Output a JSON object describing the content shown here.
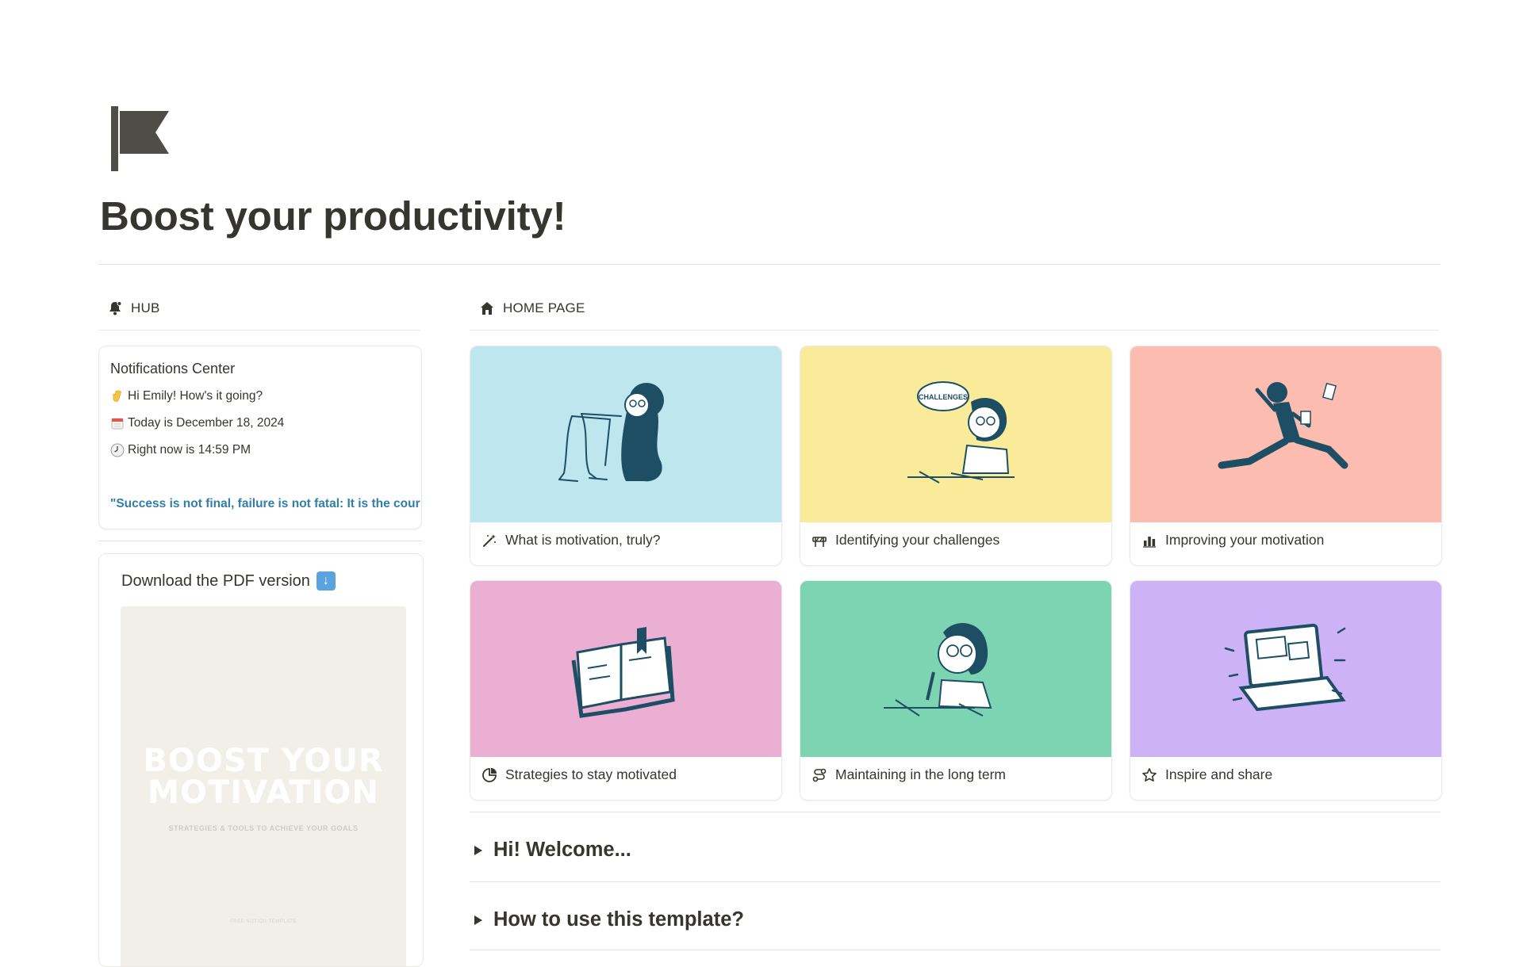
{
  "page": {
    "title": "Boost your productivity!",
    "icon": "flag-icon"
  },
  "hub": {
    "header_label": "HUB",
    "header_icon": "bell-icon",
    "notifications": {
      "title": "Notifications Center",
      "greeting": "Hi Emily! How's it going?",
      "greeting_icon": "waving-hand-icon",
      "date_text": "Today is December 18, 2024",
      "date_icon": "calendar-icon",
      "time_text": "Right now is 14:59 PM",
      "time_icon": "clock-icon",
      "quote": "\"Success is not final, failure is not fatal: It is the cour"
    },
    "download": {
      "title": "Download the PDF version",
      "title_icon": "down-arrow-icon",
      "preview_title_line1": "BOOST YOUR",
      "preview_title_line2": "MOTIVATION",
      "preview_subtitle": "STRATEGIES & TOOLS TO ACHIEVE YOUR GOALS",
      "preview_footer": "FREE NOTION TEMPLATE"
    }
  },
  "home": {
    "header_label": "HOME PAGE",
    "header_icon": "house-icon",
    "cards": [
      {
        "label": "What is motivation, truly?",
        "icon": "magic-wand-icon",
        "cover_color": "#bde6ee"
      },
      {
        "label": "Identifying your challenges",
        "icon": "road-barrier-icon",
        "cover_color": "#faeb9b"
      },
      {
        "label": "Improving your motivation",
        "icon": "bar-chart-icon",
        "cover_color": "#fcbdb0"
      },
      {
        "label": "Strategies to stay motivated",
        "icon": "pie-chart-icon",
        "cover_color": "#ecafd4"
      },
      {
        "label": "Maintaining in the long term",
        "icon": "route-icon",
        "cover_color": "#7dd4b3"
      },
      {
        "label": "Inspire and share",
        "icon": "star-icon",
        "cover_color": "#ceb2f8"
      }
    ],
    "toggles": [
      {
        "label": "Hi! Welcome..."
      },
      {
        "label": "How to use this template?"
      }
    ]
  },
  "colors": {
    "text": "#37352f",
    "quote_blue": "#337ea9",
    "illustration_ink": "#1d4e63"
  }
}
